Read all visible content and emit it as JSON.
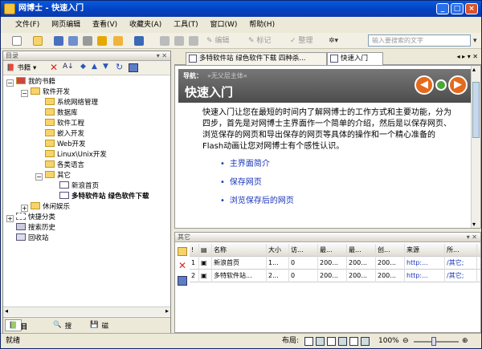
{
  "app": {
    "title": "网博士 - 快速入门"
  },
  "menu": [
    "文件(F)",
    "网页编辑",
    "查看(V)",
    "收藏夹(A)",
    "工具(T)",
    "窗口(W)",
    "帮助(H)"
  ],
  "toolbar": {
    "edit_label": "编辑",
    "mark_label": "标记",
    "organize_label": "整理",
    "search_placeholder": "输入要搜索的文字"
  },
  "left": {
    "pane_title": "目录",
    "bookmark_label": "书籍",
    "tree": {
      "root": "我的书籍",
      "software_dev": "软件开发",
      "children": [
        "系统网络管理",
        "数据库",
        "软件工程",
        "嵌入开发",
        "Web开发",
        "Linux\\Unix开发",
        "各类语言"
      ],
      "other": "其它",
      "other_children": [
        "新浪首页",
        "多特软件站 绿色软件下载"
      ],
      "leisure": "休闲娱乐",
      "quick_cat": "快捷分类",
      "search_hist": "搜索历史",
      "recycle": "回收站"
    },
    "tabs": [
      "目录",
      "搜索",
      "磁盘"
    ]
  },
  "tabs": {
    "tab1": "多特软件站 绿色软件下载 四种杀...",
    "tab2": "快速入门"
  },
  "doc": {
    "nav_label": "导航：",
    "nav_value": "»无父层主体«",
    "title": "快速入门",
    "paragraph": "快速入门让您在最短的时间内了解网博士的工作方式和主要功能，分为四步，首先是对网博士主界面作一个简单的介绍，然后是以保存网页、浏览保存的网页和导出保存的网页等具体的操作和一个精心准备的Flash动画让您对网博士有个感性认识。",
    "links": [
      "主界面简介",
      "保存网页",
      "浏览保存后的网页"
    ]
  },
  "bottom": {
    "pane_title": "其它",
    "columns": [
      "名称",
      "大小",
      "访...",
      "最...",
      "最...",
      "创...",
      "来源",
      "所..."
    ],
    "rows": [
      {
        "num": "1",
        "name": "新浪首页",
        "size": "1...",
        "visits": "0",
        "d1": "200...",
        "d2": "200...",
        "d3": "200...",
        "src": "http:...",
        "loc": "/其它;"
      },
      {
        "num": "2",
        "name": "多特软件站...",
        "size": "2...",
        "visits": "0",
        "d1": "200...",
        "d2": "200...",
        "d3": "200...",
        "src": "http:...",
        "loc": "/其它;"
      }
    ]
  },
  "status": {
    "left": "就绪",
    "layout_label": "布局:",
    "zoom": "100%"
  }
}
